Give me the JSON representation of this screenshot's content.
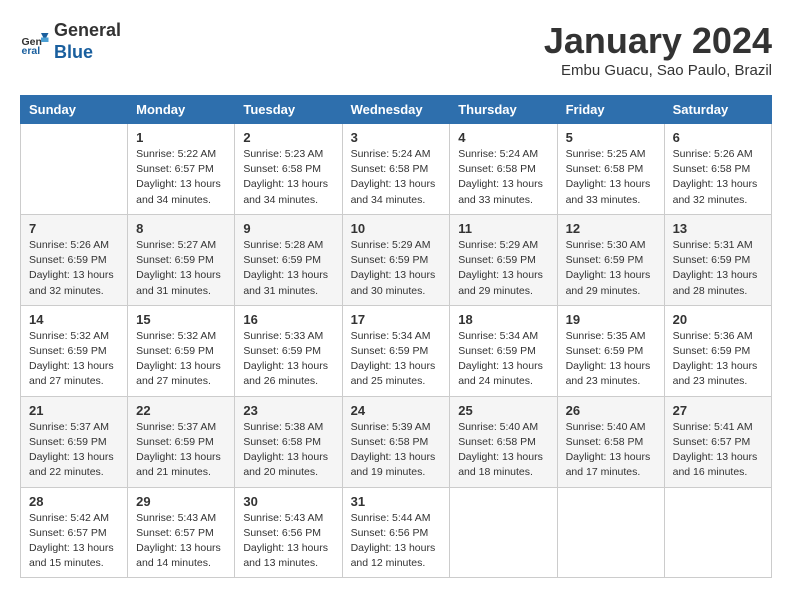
{
  "header": {
    "logo_line1": "General",
    "logo_line2": "Blue",
    "title": "January 2024",
    "location": "Embu Guacu, Sao Paulo, Brazil"
  },
  "weekdays": [
    "Sunday",
    "Monday",
    "Tuesday",
    "Wednesday",
    "Thursday",
    "Friday",
    "Saturday"
  ],
  "weeks": [
    [
      {
        "day": "",
        "info": ""
      },
      {
        "day": "1",
        "info": "Sunrise: 5:22 AM\nSunset: 6:57 PM\nDaylight: 13 hours\nand 34 minutes."
      },
      {
        "day": "2",
        "info": "Sunrise: 5:23 AM\nSunset: 6:58 PM\nDaylight: 13 hours\nand 34 minutes."
      },
      {
        "day": "3",
        "info": "Sunrise: 5:24 AM\nSunset: 6:58 PM\nDaylight: 13 hours\nand 34 minutes."
      },
      {
        "day": "4",
        "info": "Sunrise: 5:24 AM\nSunset: 6:58 PM\nDaylight: 13 hours\nand 33 minutes."
      },
      {
        "day": "5",
        "info": "Sunrise: 5:25 AM\nSunset: 6:58 PM\nDaylight: 13 hours\nand 33 minutes."
      },
      {
        "day": "6",
        "info": "Sunrise: 5:26 AM\nSunset: 6:58 PM\nDaylight: 13 hours\nand 32 minutes."
      }
    ],
    [
      {
        "day": "7",
        "info": "Sunrise: 5:26 AM\nSunset: 6:59 PM\nDaylight: 13 hours\nand 32 minutes."
      },
      {
        "day": "8",
        "info": "Sunrise: 5:27 AM\nSunset: 6:59 PM\nDaylight: 13 hours\nand 31 minutes."
      },
      {
        "day": "9",
        "info": "Sunrise: 5:28 AM\nSunset: 6:59 PM\nDaylight: 13 hours\nand 31 minutes."
      },
      {
        "day": "10",
        "info": "Sunrise: 5:29 AM\nSunset: 6:59 PM\nDaylight: 13 hours\nand 30 minutes."
      },
      {
        "day": "11",
        "info": "Sunrise: 5:29 AM\nSunset: 6:59 PM\nDaylight: 13 hours\nand 29 minutes."
      },
      {
        "day": "12",
        "info": "Sunrise: 5:30 AM\nSunset: 6:59 PM\nDaylight: 13 hours\nand 29 minutes."
      },
      {
        "day": "13",
        "info": "Sunrise: 5:31 AM\nSunset: 6:59 PM\nDaylight: 13 hours\nand 28 minutes."
      }
    ],
    [
      {
        "day": "14",
        "info": "Sunrise: 5:32 AM\nSunset: 6:59 PM\nDaylight: 13 hours\nand 27 minutes."
      },
      {
        "day": "15",
        "info": "Sunrise: 5:32 AM\nSunset: 6:59 PM\nDaylight: 13 hours\nand 27 minutes."
      },
      {
        "day": "16",
        "info": "Sunrise: 5:33 AM\nSunset: 6:59 PM\nDaylight: 13 hours\nand 26 minutes."
      },
      {
        "day": "17",
        "info": "Sunrise: 5:34 AM\nSunset: 6:59 PM\nDaylight: 13 hours\nand 25 minutes."
      },
      {
        "day": "18",
        "info": "Sunrise: 5:34 AM\nSunset: 6:59 PM\nDaylight: 13 hours\nand 24 minutes."
      },
      {
        "day": "19",
        "info": "Sunrise: 5:35 AM\nSunset: 6:59 PM\nDaylight: 13 hours\nand 23 minutes."
      },
      {
        "day": "20",
        "info": "Sunrise: 5:36 AM\nSunset: 6:59 PM\nDaylight: 13 hours\nand 23 minutes."
      }
    ],
    [
      {
        "day": "21",
        "info": "Sunrise: 5:37 AM\nSunset: 6:59 PM\nDaylight: 13 hours\nand 22 minutes."
      },
      {
        "day": "22",
        "info": "Sunrise: 5:37 AM\nSunset: 6:59 PM\nDaylight: 13 hours\nand 21 minutes."
      },
      {
        "day": "23",
        "info": "Sunrise: 5:38 AM\nSunset: 6:58 PM\nDaylight: 13 hours\nand 20 minutes."
      },
      {
        "day": "24",
        "info": "Sunrise: 5:39 AM\nSunset: 6:58 PM\nDaylight: 13 hours\nand 19 minutes."
      },
      {
        "day": "25",
        "info": "Sunrise: 5:40 AM\nSunset: 6:58 PM\nDaylight: 13 hours\nand 18 minutes."
      },
      {
        "day": "26",
        "info": "Sunrise: 5:40 AM\nSunset: 6:58 PM\nDaylight: 13 hours\nand 17 minutes."
      },
      {
        "day": "27",
        "info": "Sunrise: 5:41 AM\nSunset: 6:57 PM\nDaylight: 13 hours\nand 16 minutes."
      }
    ],
    [
      {
        "day": "28",
        "info": "Sunrise: 5:42 AM\nSunset: 6:57 PM\nDaylight: 13 hours\nand 15 minutes."
      },
      {
        "day": "29",
        "info": "Sunrise: 5:43 AM\nSunset: 6:57 PM\nDaylight: 13 hours\nand 14 minutes."
      },
      {
        "day": "30",
        "info": "Sunrise: 5:43 AM\nSunset: 6:56 PM\nDaylight: 13 hours\nand 13 minutes."
      },
      {
        "day": "31",
        "info": "Sunrise: 5:44 AM\nSunset: 6:56 PM\nDaylight: 13 hours\nand 12 minutes."
      },
      {
        "day": "",
        "info": ""
      },
      {
        "day": "",
        "info": ""
      },
      {
        "day": "",
        "info": ""
      }
    ]
  ]
}
